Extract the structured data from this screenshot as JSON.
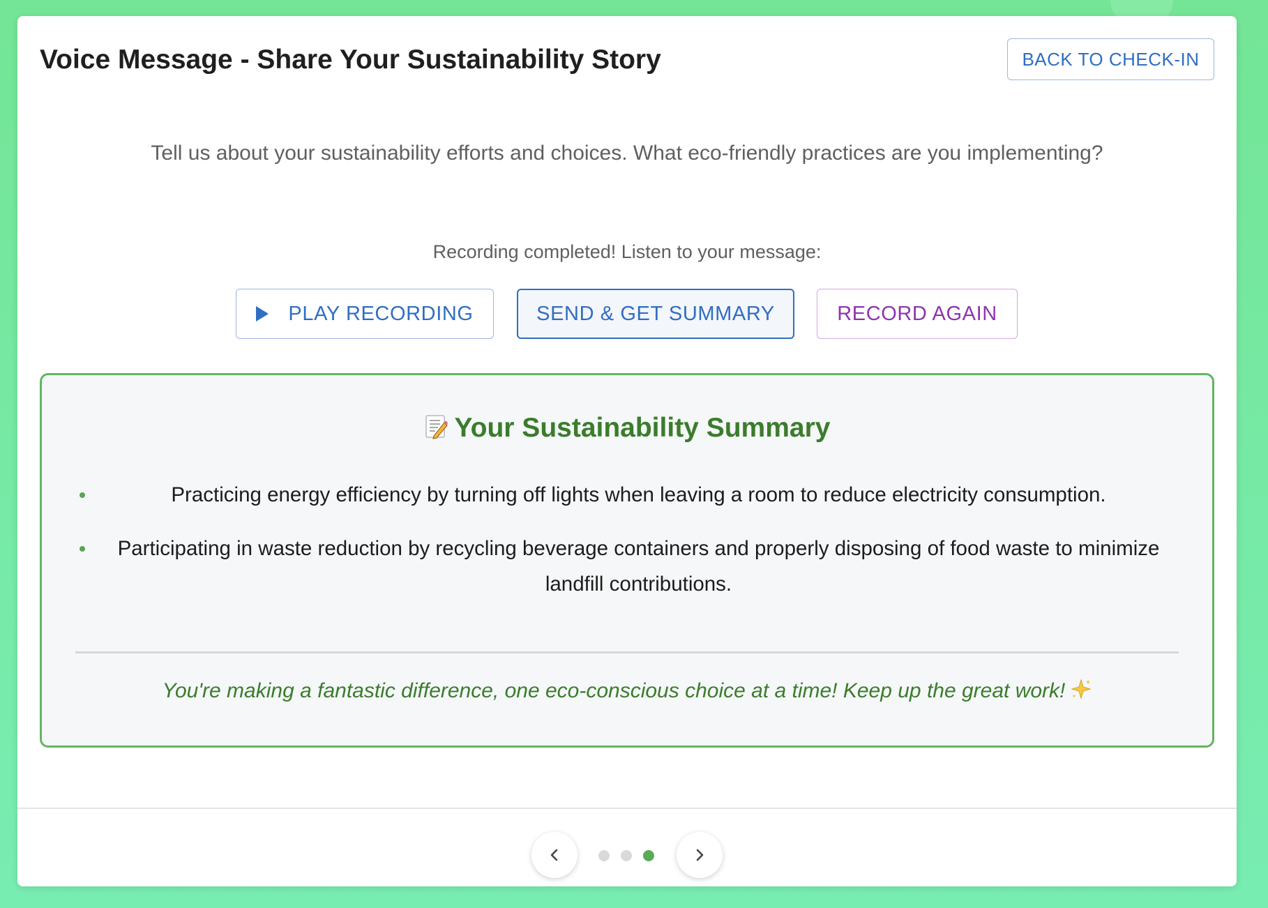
{
  "header": {
    "title": "Voice Message - Share Your Sustainability Story",
    "back_button_label": "BACK TO CHECK-IN"
  },
  "prompt": "Tell us about your sustainability efforts and choices. What eco-friendly practices are you implementing?",
  "recording": {
    "status_text": "Recording completed! Listen to your message:",
    "play_label": "PLAY RECORDING",
    "send_label": "SEND & GET SUMMARY",
    "record_again_label": "RECORD AGAIN"
  },
  "summary": {
    "heading": "Your Sustainability Summary",
    "heading_icon": "memo-icon",
    "items": [
      {
        "text": "Practicing energy efficiency by turning off lights when leaving a room to reduce electricity consumption."
      },
      {
        "text": "Participating in waste reduction by recycling beverage containers and properly disposing of food waste to minimize landfill contributions."
      }
    ],
    "encouragement": "You're making a fantastic difference, one eco-conscious choice at a time! Keep up the great work!",
    "encouragement_icon": "sparkle-icon"
  },
  "pagination": {
    "total_pages": 3,
    "current_page": 3,
    "prev_icon": "chevron-left-icon",
    "next_icon": "chevron-right-icon"
  },
  "colors": {
    "background": "#74e596",
    "accent_blue": "#2f6ec2",
    "accent_green": "#3b7c2b",
    "accent_purple": "#8e33b0",
    "summary_border": "#64b45f"
  }
}
